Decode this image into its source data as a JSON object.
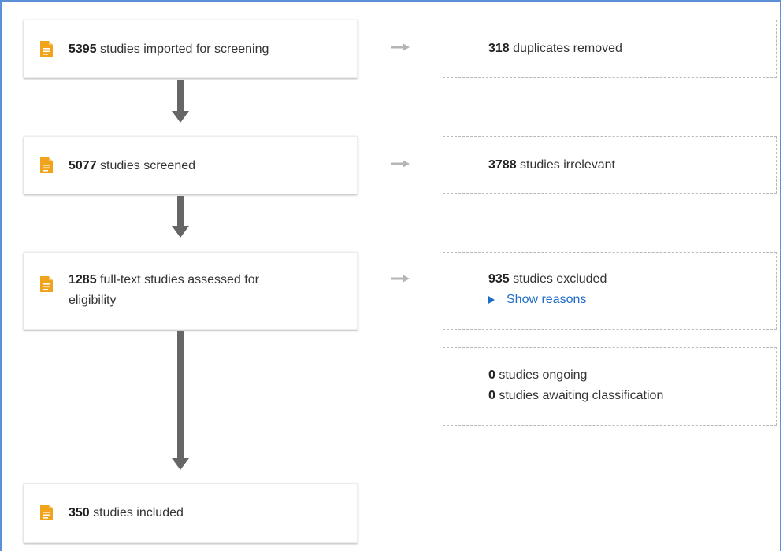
{
  "flow": {
    "imported": {
      "count": "5395",
      "text": "studies imported for screening"
    },
    "screened": {
      "count": "5077",
      "text": "studies screened"
    },
    "fulltext": {
      "count": "1285",
      "text": "full-text studies assessed for eligibility"
    },
    "included": {
      "count": "350",
      "text": "studies included"
    }
  },
  "side": {
    "duplicates": {
      "count": "318",
      "text": "duplicates removed"
    },
    "irrelevant": {
      "count": "3788",
      "text": "studies irrelevant"
    },
    "excluded": {
      "count": "935",
      "text": "studies excluded",
      "link": "Show reasons"
    },
    "ongoing": {
      "count": "0",
      "text": "studies ongoing"
    },
    "awaiting": {
      "count": "0",
      "text": "studies awaiting classification"
    }
  },
  "colors": {
    "icon": "#f2a31c",
    "link": "#1f6dc7",
    "arrow": "#666666",
    "frame": "#5b8fd6"
  }
}
